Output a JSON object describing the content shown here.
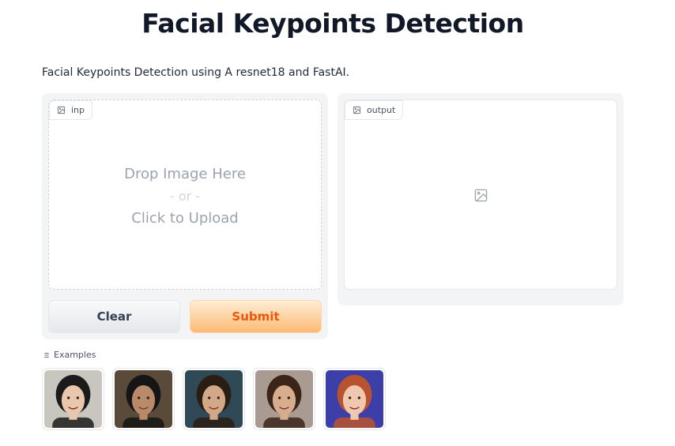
{
  "header": {
    "title": "Facial Keypoints Detection",
    "description": "Facial Keypoints Detection using A resnet18 and FastAI."
  },
  "input": {
    "label": "inp",
    "drop_line1": "Drop Image Here",
    "drop_or": "- or -",
    "drop_line2": "Click to Upload"
  },
  "output": {
    "label": "output"
  },
  "buttons": {
    "clear_label": "Clear",
    "submit_label": "Submit"
  },
  "examples": {
    "label": "Examples",
    "items": [
      {
        "bg": "#c9c6c0",
        "skin": "#e8c7ae",
        "hair": "#1b1b1b"
      },
      {
        "bg": "#5a4a3a",
        "skin": "#b98a6a",
        "hair": "#151515"
      },
      {
        "bg": "#2f4a56",
        "skin": "#d3a886",
        "hair": "#2a1d14"
      },
      {
        "bg": "#a99a92",
        "skin": "#d7ad8e",
        "hair": "#3a2518"
      },
      {
        "bg": "#3c3fa8",
        "skin": "#f0c8b0",
        "hair": "#b9532f"
      }
    ]
  },
  "colors": {
    "accent": "#ea580c",
    "panel_bg": "#f3f4f6"
  }
}
